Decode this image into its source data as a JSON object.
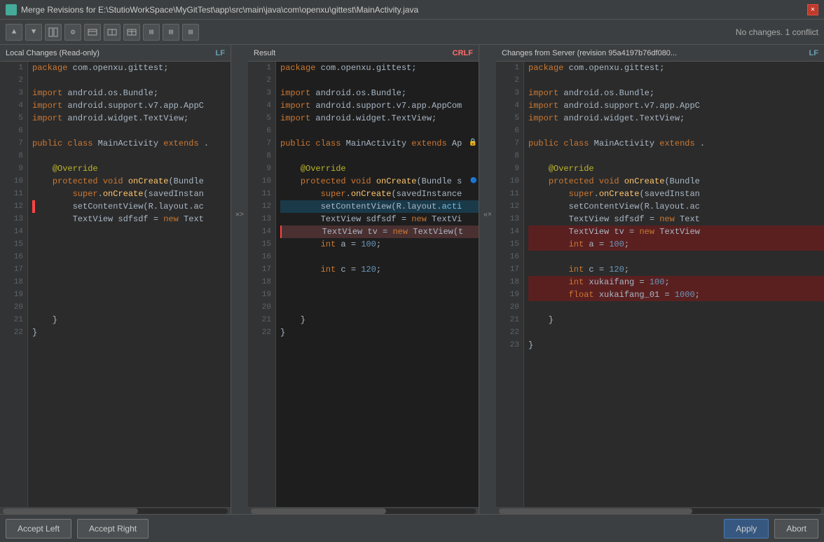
{
  "titleBar": {
    "title": "Merge Revisions for E:\\StutioWorkSpace\\MyGitTest\\app\\src\\main\\java\\com\\openxu\\gittest\\MainActivity.java",
    "closeLabel": "✕"
  },
  "toolbar": {
    "statusText": "No changes. 1 conflict",
    "buttons": [
      "↑",
      "↓",
      "⊞",
      "⚙",
      "⊡",
      "⊡",
      "⊡",
      "⊠",
      "⊠",
      "⊠"
    ]
  },
  "leftPanel": {
    "title": "Local Changes (Read-only)",
    "label": "LF",
    "lines": [
      {
        "num": 1,
        "code": "package com.openxu.gittest;"
      },
      {
        "num": 2,
        "code": ""
      },
      {
        "num": 3,
        "code": "import android.os.Bundle;"
      },
      {
        "num": 4,
        "code": "import android.support.v7.app.AppC"
      },
      {
        "num": 5,
        "code": "import android.widget.TextView;"
      },
      {
        "num": 6,
        "code": ""
      },
      {
        "num": 7,
        "code": "public class MainActivity extends ."
      },
      {
        "num": 8,
        "code": ""
      },
      {
        "num": 9,
        "code": "    @Override"
      },
      {
        "num": 10,
        "code": "    protected void onCreate(Bundle"
      },
      {
        "num": 11,
        "code": "        super.onCreate(savedInstan"
      },
      {
        "num": 12,
        "code": "        setContentView(R.layout.ac"
      },
      {
        "num": 13,
        "code": "        TextView sdfsdf = new Text"
      },
      {
        "num": 14,
        "code": ""
      },
      {
        "num": 15,
        "code": ""
      },
      {
        "num": 16,
        "code": ""
      },
      {
        "num": 17,
        "code": ""
      },
      {
        "num": 18,
        "code": ""
      },
      {
        "num": 19,
        "code": ""
      },
      {
        "num": 20,
        "code": ""
      },
      {
        "num": 21,
        "code": "    }"
      },
      {
        "num": 22,
        "code": "}"
      }
    ]
  },
  "centerPanel": {
    "title": "Result",
    "label": "CRLF",
    "lines": [
      {
        "num": 1,
        "code": "package com.openxu.gittest;"
      },
      {
        "num": 2,
        "code": ""
      },
      {
        "num": 3,
        "code": "import android.os.Bundle;"
      },
      {
        "num": 4,
        "code": "import android.support.v7.app.AppCom"
      },
      {
        "num": 5,
        "code": "import android.widget.TextView;"
      },
      {
        "num": 6,
        "code": ""
      },
      {
        "num": 7,
        "code": "public class MainActivity extends Ap",
        "hasIcon": true
      },
      {
        "num": 8,
        "code": ""
      },
      {
        "num": 9,
        "code": "    @Override"
      },
      {
        "num": 10,
        "code": "    protected void onCreate(Bundle s",
        "hasIcon": true
      },
      {
        "num": 11,
        "code": "        super.onCreate(savedInstance"
      },
      {
        "num": 12,
        "code": "        setContentView(R.layout.acti",
        "changed": true
      },
      {
        "num": 13,
        "code": "        TextView sdfsdf = new TextVi"
      },
      {
        "num": 14,
        "code": "        TextView tv = new TextView(t",
        "conflict": true
      },
      {
        "num": 15,
        "code": "        int a = 100;"
      },
      {
        "num": 16,
        "code": ""
      },
      {
        "num": 17,
        "code": "        int c = 120;"
      },
      {
        "num": 18,
        "code": ""
      },
      {
        "num": 19,
        "code": ""
      },
      {
        "num": 20,
        "code": ""
      },
      {
        "num": 21,
        "code": "    }"
      },
      {
        "num": 22,
        "code": "}"
      }
    ]
  },
  "rightPanel": {
    "title": "Changes from Server (revision 95a4197b76df080...",
    "label": "LF",
    "lines": [
      {
        "num": 1,
        "code": "package com.openxu.gittest;"
      },
      {
        "num": 2,
        "code": ""
      },
      {
        "num": 3,
        "code": "import android.os.Bundle;"
      },
      {
        "num": 4,
        "code": "import android.support.v7.app.AppC"
      },
      {
        "num": 5,
        "code": "import android.widget.TextView;"
      },
      {
        "num": 6,
        "code": ""
      },
      {
        "num": 7,
        "code": "public class MainActivity extends ."
      },
      {
        "num": 8,
        "code": ""
      },
      {
        "num": 9,
        "code": "    @Override"
      },
      {
        "num": 10,
        "code": "    protected void onCreate(Bundle"
      },
      {
        "num": 11,
        "code": "        super.onCreate(savedInstan"
      },
      {
        "num": 12,
        "code": "        setContentView(R.layout.ac"
      },
      {
        "num": 13,
        "code": "        TextView sdfsdf = new Text"
      },
      {
        "num": 14,
        "code": "        TextView tv = new TextView",
        "conflict": true
      },
      {
        "num": 15,
        "code": "        int a = 100;",
        "conflict": true
      },
      {
        "num": 16,
        "code": ""
      },
      {
        "num": 17,
        "code": "        int c = 120;"
      },
      {
        "num": 18,
        "code": "        int xukaifang = 100;",
        "conflict": true
      },
      {
        "num": 19,
        "code": "        float xukaifang_01 = 1000;",
        "conflict": true
      },
      {
        "num": 20,
        "code": ""
      },
      {
        "num": 21,
        "code": "    }"
      },
      {
        "num": 22,
        "code": ""
      },
      {
        "num": 23,
        "code": "}"
      }
    ]
  },
  "bottomBar": {
    "acceptLeftLabel": "Accept Left",
    "acceptRightLabel": "Accept Right",
    "applyLabel": "Apply",
    "abortLabel": "Abort"
  }
}
